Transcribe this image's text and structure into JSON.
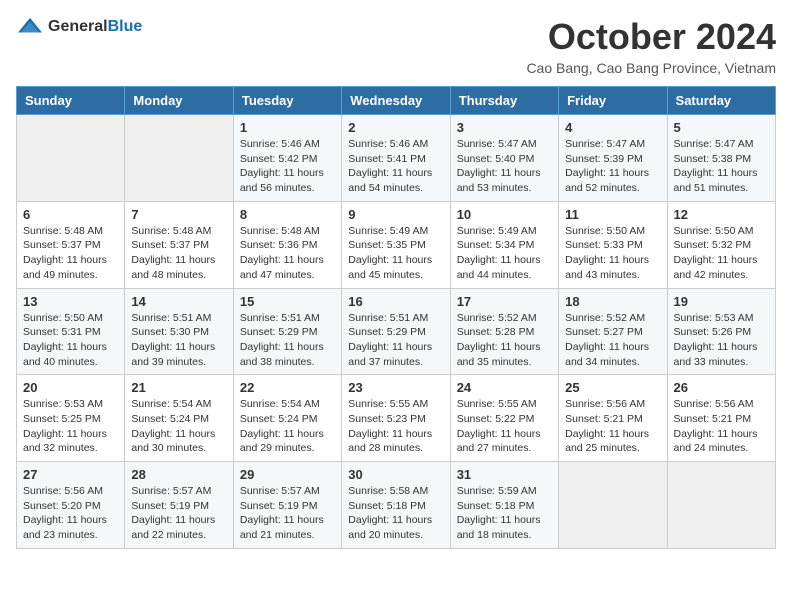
{
  "header": {
    "logo_general": "General",
    "logo_blue": "Blue",
    "month": "October 2024",
    "location": "Cao Bang, Cao Bang Province, Vietnam"
  },
  "weekdays": [
    "Sunday",
    "Monday",
    "Tuesday",
    "Wednesday",
    "Thursday",
    "Friday",
    "Saturday"
  ],
  "weeks": [
    [
      {
        "day": "",
        "sunrise": "",
        "sunset": "",
        "daylight": "",
        "empty": true
      },
      {
        "day": "",
        "sunrise": "",
        "sunset": "",
        "daylight": "",
        "empty": true
      },
      {
        "day": "1",
        "sunrise": "Sunrise: 5:46 AM",
        "sunset": "Sunset: 5:42 PM",
        "daylight": "Daylight: 11 hours and 56 minutes."
      },
      {
        "day": "2",
        "sunrise": "Sunrise: 5:46 AM",
        "sunset": "Sunset: 5:41 PM",
        "daylight": "Daylight: 11 hours and 54 minutes."
      },
      {
        "day": "3",
        "sunrise": "Sunrise: 5:47 AM",
        "sunset": "Sunset: 5:40 PM",
        "daylight": "Daylight: 11 hours and 53 minutes."
      },
      {
        "day": "4",
        "sunrise": "Sunrise: 5:47 AM",
        "sunset": "Sunset: 5:39 PM",
        "daylight": "Daylight: 11 hours and 52 minutes."
      },
      {
        "day": "5",
        "sunrise": "Sunrise: 5:47 AM",
        "sunset": "Sunset: 5:38 PM",
        "daylight": "Daylight: 11 hours and 51 minutes."
      }
    ],
    [
      {
        "day": "6",
        "sunrise": "Sunrise: 5:48 AM",
        "sunset": "Sunset: 5:37 PM",
        "daylight": "Daylight: 11 hours and 49 minutes."
      },
      {
        "day": "7",
        "sunrise": "Sunrise: 5:48 AM",
        "sunset": "Sunset: 5:37 PM",
        "daylight": "Daylight: 11 hours and 48 minutes."
      },
      {
        "day": "8",
        "sunrise": "Sunrise: 5:48 AM",
        "sunset": "Sunset: 5:36 PM",
        "daylight": "Daylight: 11 hours and 47 minutes."
      },
      {
        "day": "9",
        "sunrise": "Sunrise: 5:49 AM",
        "sunset": "Sunset: 5:35 PM",
        "daylight": "Daylight: 11 hours and 45 minutes."
      },
      {
        "day": "10",
        "sunrise": "Sunrise: 5:49 AM",
        "sunset": "Sunset: 5:34 PM",
        "daylight": "Daylight: 11 hours and 44 minutes."
      },
      {
        "day": "11",
        "sunrise": "Sunrise: 5:50 AM",
        "sunset": "Sunset: 5:33 PM",
        "daylight": "Daylight: 11 hours and 43 minutes."
      },
      {
        "day": "12",
        "sunrise": "Sunrise: 5:50 AM",
        "sunset": "Sunset: 5:32 PM",
        "daylight": "Daylight: 11 hours and 42 minutes."
      }
    ],
    [
      {
        "day": "13",
        "sunrise": "Sunrise: 5:50 AM",
        "sunset": "Sunset: 5:31 PM",
        "daylight": "Daylight: 11 hours and 40 minutes."
      },
      {
        "day": "14",
        "sunrise": "Sunrise: 5:51 AM",
        "sunset": "Sunset: 5:30 PM",
        "daylight": "Daylight: 11 hours and 39 minutes."
      },
      {
        "day": "15",
        "sunrise": "Sunrise: 5:51 AM",
        "sunset": "Sunset: 5:29 PM",
        "daylight": "Daylight: 11 hours and 38 minutes."
      },
      {
        "day": "16",
        "sunrise": "Sunrise: 5:51 AM",
        "sunset": "Sunset: 5:29 PM",
        "daylight": "Daylight: 11 hours and 37 minutes."
      },
      {
        "day": "17",
        "sunrise": "Sunrise: 5:52 AM",
        "sunset": "Sunset: 5:28 PM",
        "daylight": "Daylight: 11 hours and 35 minutes."
      },
      {
        "day": "18",
        "sunrise": "Sunrise: 5:52 AM",
        "sunset": "Sunset: 5:27 PM",
        "daylight": "Daylight: 11 hours and 34 minutes."
      },
      {
        "day": "19",
        "sunrise": "Sunrise: 5:53 AM",
        "sunset": "Sunset: 5:26 PM",
        "daylight": "Daylight: 11 hours and 33 minutes."
      }
    ],
    [
      {
        "day": "20",
        "sunrise": "Sunrise: 5:53 AM",
        "sunset": "Sunset: 5:25 PM",
        "daylight": "Daylight: 11 hours and 32 minutes."
      },
      {
        "day": "21",
        "sunrise": "Sunrise: 5:54 AM",
        "sunset": "Sunset: 5:24 PM",
        "daylight": "Daylight: 11 hours and 30 minutes."
      },
      {
        "day": "22",
        "sunrise": "Sunrise: 5:54 AM",
        "sunset": "Sunset: 5:24 PM",
        "daylight": "Daylight: 11 hours and 29 minutes."
      },
      {
        "day": "23",
        "sunrise": "Sunrise: 5:55 AM",
        "sunset": "Sunset: 5:23 PM",
        "daylight": "Daylight: 11 hours and 28 minutes."
      },
      {
        "day": "24",
        "sunrise": "Sunrise: 5:55 AM",
        "sunset": "Sunset: 5:22 PM",
        "daylight": "Daylight: 11 hours and 27 minutes."
      },
      {
        "day": "25",
        "sunrise": "Sunrise: 5:56 AM",
        "sunset": "Sunset: 5:21 PM",
        "daylight": "Daylight: 11 hours and 25 minutes."
      },
      {
        "day": "26",
        "sunrise": "Sunrise: 5:56 AM",
        "sunset": "Sunset: 5:21 PM",
        "daylight": "Daylight: 11 hours and 24 minutes."
      }
    ],
    [
      {
        "day": "27",
        "sunrise": "Sunrise: 5:56 AM",
        "sunset": "Sunset: 5:20 PM",
        "daylight": "Daylight: 11 hours and 23 minutes."
      },
      {
        "day": "28",
        "sunrise": "Sunrise: 5:57 AM",
        "sunset": "Sunset: 5:19 PM",
        "daylight": "Daylight: 11 hours and 22 minutes."
      },
      {
        "day": "29",
        "sunrise": "Sunrise: 5:57 AM",
        "sunset": "Sunset: 5:19 PM",
        "daylight": "Daylight: 11 hours and 21 minutes."
      },
      {
        "day": "30",
        "sunrise": "Sunrise: 5:58 AM",
        "sunset": "Sunset: 5:18 PM",
        "daylight": "Daylight: 11 hours and 20 minutes."
      },
      {
        "day": "31",
        "sunrise": "Sunrise: 5:59 AM",
        "sunset": "Sunset: 5:18 PM",
        "daylight": "Daylight: 11 hours and 18 minutes."
      },
      {
        "day": "",
        "sunrise": "",
        "sunset": "",
        "daylight": "",
        "empty": true
      },
      {
        "day": "",
        "sunrise": "",
        "sunset": "",
        "daylight": "",
        "empty": true
      }
    ]
  ]
}
